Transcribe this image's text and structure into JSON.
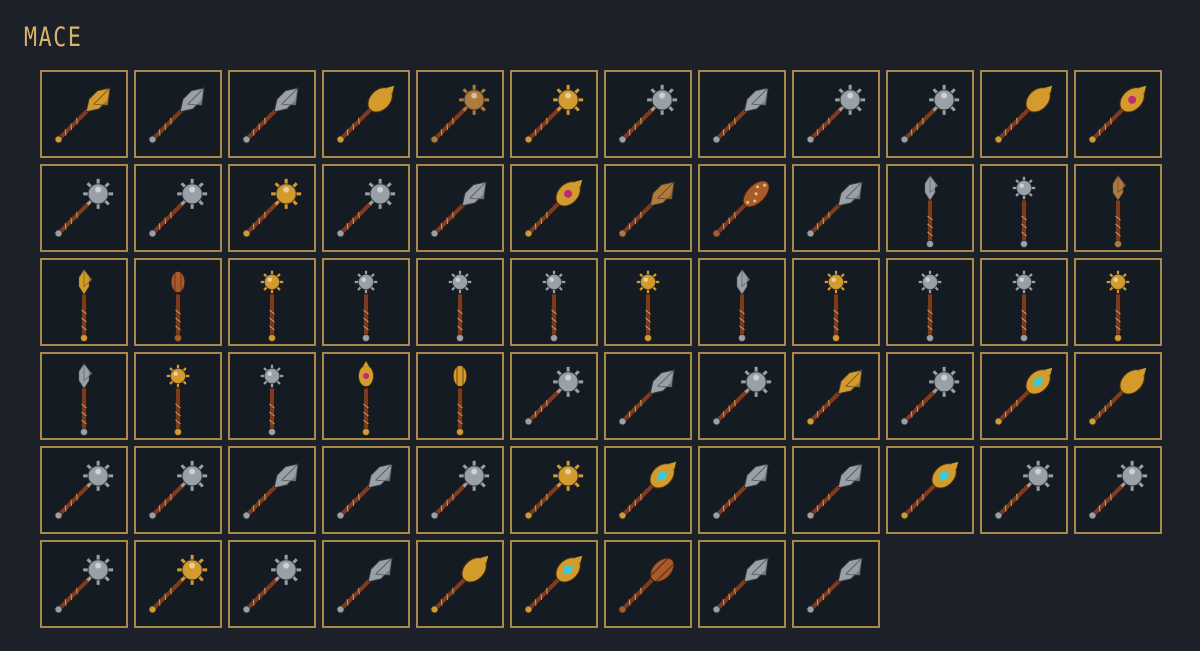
{
  "header": {
    "title": "MACE"
  },
  "items": [
    {
      "style": "flanged-gold",
      "pose": "diag"
    },
    {
      "style": "flanged-steel",
      "pose": "diag"
    },
    {
      "style": "flanged-steel",
      "pose": "diag"
    },
    {
      "style": "ornate-gold",
      "pose": "diag"
    },
    {
      "style": "spiked-bronze",
      "pose": "diag"
    },
    {
      "style": "spiked-gold",
      "pose": "diag"
    },
    {
      "style": "spiked-steel",
      "pose": "diag"
    },
    {
      "style": "flanged-steel",
      "pose": "diag"
    },
    {
      "style": "spiked-steel",
      "pose": "diag"
    },
    {
      "style": "spiked-steel",
      "pose": "diag"
    },
    {
      "style": "ornate-gold",
      "pose": "diag"
    },
    {
      "style": "jeweled-gold",
      "pose": "diag"
    },
    {
      "style": "spiked-steel",
      "pose": "diag"
    },
    {
      "style": "spiked-steel",
      "pose": "diag"
    },
    {
      "style": "spiked-gold",
      "pose": "diag"
    },
    {
      "style": "spiked-steel",
      "pose": "diag"
    },
    {
      "style": "flanged-steel",
      "pose": "diag"
    },
    {
      "style": "jeweled-gold",
      "pose": "diag"
    },
    {
      "style": "flanged-bronze",
      "pose": "diag"
    },
    {
      "style": "studded-club",
      "pose": "diag"
    },
    {
      "style": "flanged-steel",
      "pose": "diag"
    },
    {
      "style": "flanged-steel",
      "pose": "vert"
    },
    {
      "style": "spiked-steel",
      "pose": "vert"
    },
    {
      "style": "flanged-bronze",
      "pose": "vert"
    },
    {
      "style": "flanged-gold",
      "pose": "vert"
    },
    {
      "style": "ribbed-copper",
      "pose": "vert"
    },
    {
      "style": "spiked-gold",
      "pose": "vert"
    },
    {
      "style": "spiked-steel",
      "pose": "vert"
    },
    {
      "style": "spiked-steel",
      "pose": "vert"
    },
    {
      "style": "spiked-steel",
      "pose": "vert"
    },
    {
      "style": "spiked-gold",
      "pose": "vert"
    },
    {
      "style": "flanged-steel",
      "pose": "vert"
    },
    {
      "style": "spiked-gold",
      "pose": "vert"
    },
    {
      "style": "spiked-steel",
      "pose": "vert"
    },
    {
      "style": "spiked-steel",
      "pose": "vert"
    },
    {
      "style": "spiked-gold",
      "pose": "vert"
    },
    {
      "style": "flanged-steel",
      "pose": "vert"
    },
    {
      "style": "spiked-gold",
      "pose": "vert"
    },
    {
      "style": "spiked-steel",
      "pose": "vert"
    },
    {
      "style": "jeweled-gold",
      "pose": "vert"
    },
    {
      "style": "ribbed-gold",
      "pose": "vert"
    },
    {
      "style": "spiked-steel",
      "pose": "diag"
    },
    {
      "style": "flanged-steel",
      "pose": "diag"
    },
    {
      "style": "spiked-steel",
      "pose": "diag"
    },
    {
      "style": "flanged-gold",
      "pose": "diag"
    },
    {
      "style": "spiked-steel",
      "pose": "diag"
    },
    {
      "style": "crystal-gold",
      "pose": "diag"
    },
    {
      "style": "ornate-gold",
      "pose": "diag"
    },
    {
      "style": "spiked-steel",
      "pose": "diag"
    },
    {
      "style": "spiked-steel",
      "pose": "diag"
    },
    {
      "style": "flanged-steel",
      "pose": "diag"
    },
    {
      "style": "flanged-steel",
      "pose": "diag"
    },
    {
      "style": "spiked-steel",
      "pose": "diag"
    },
    {
      "style": "spiked-gold",
      "pose": "diag"
    },
    {
      "style": "crystal-gold",
      "pose": "diag"
    },
    {
      "style": "flanged-steel",
      "pose": "diag"
    },
    {
      "style": "flanged-steel",
      "pose": "diag"
    },
    {
      "style": "crystal-gold",
      "pose": "diag"
    },
    {
      "style": "spiked-steel",
      "pose": "diag"
    },
    {
      "style": "spiked-steel",
      "pose": "diag"
    },
    {
      "style": "spiked-steel",
      "pose": "diag"
    },
    {
      "style": "spiked-gold",
      "pose": "diag"
    },
    {
      "style": "spiked-steel",
      "pose": "diag"
    },
    {
      "style": "flanged-steel",
      "pose": "diag"
    },
    {
      "style": "ornate-gold",
      "pose": "diag"
    },
    {
      "style": "crystal-gold",
      "pose": "diag"
    },
    {
      "style": "ribbed-copper",
      "pose": "diag"
    },
    {
      "style": "flanged-steel",
      "pose": "diag"
    },
    {
      "style": "flanged-steel",
      "pose": "diag"
    }
  ],
  "colors": {
    "steel": "#9aa0a8",
    "gold": "#d39a2c",
    "bronze": "#b07a3a",
    "copper": "#a85a2a",
    "handle": "#7a3b22",
    "border": "#a9894a",
    "jewel": "#c0297a",
    "crystal": "#3fc8d8"
  }
}
